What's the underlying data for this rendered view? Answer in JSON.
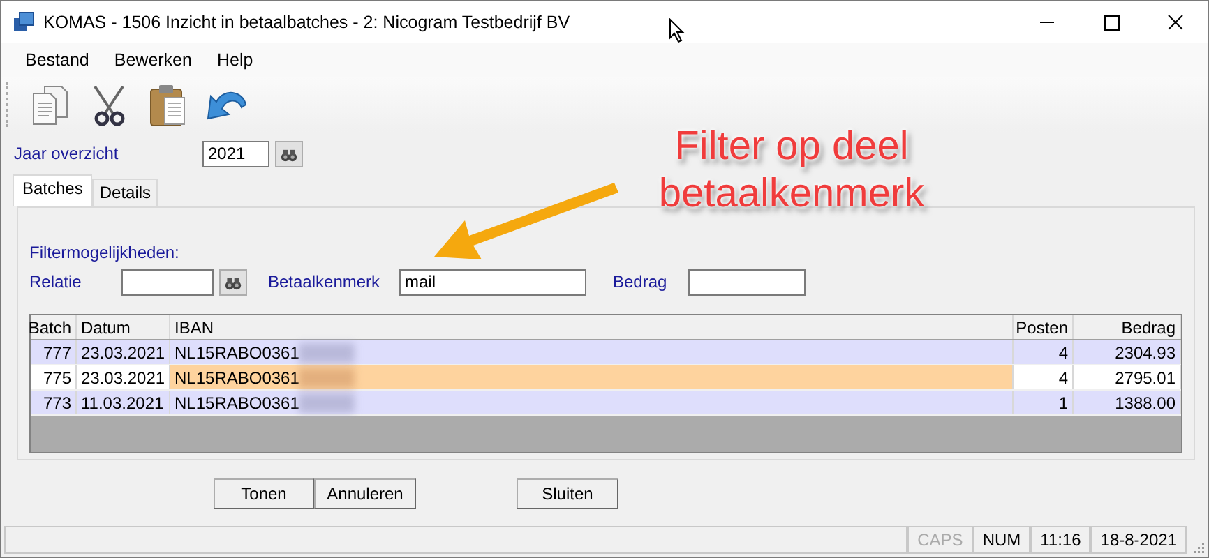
{
  "window": {
    "title": "KOMAS - 1506 Inzicht in betaalbatches - 2: Nicogram Testbedrijf BV"
  },
  "menu": [
    "Bestand",
    "Bewerken",
    "Help"
  ],
  "year": {
    "label": "Jaar overzicht",
    "value": "2021"
  },
  "tabs": [
    {
      "label": "Batches",
      "selected": true
    },
    {
      "label": "Details",
      "selected": false
    }
  ],
  "filter": {
    "heading": "Filtermogelijkheden:",
    "relatie_label": "Relatie",
    "kenmerk_label": "Betaalkenmerk",
    "kenmerk_value": "mail",
    "bedrag_label": "Bedrag"
  },
  "table": {
    "columns": [
      "Batch",
      "Datum",
      "IBAN",
      "Posten",
      "Bedrag"
    ],
    "rows": [
      {
        "cells": [
          "777",
          "23.03.2021",
          "NL15RABO0361",
          "4",
          "2304.93"
        ],
        "selected": false
      },
      {
        "cells": [
          "775",
          "23.03.2021",
          "NL15RABO0361",
          "4",
          "2795.01"
        ],
        "selected": true
      },
      {
        "cells": [
          "773",
          "11.03.2021",
          "NL15RABO0361",
          "1",
          "1388.00"
        ],
        "selected": false
      }
    ]
  },
  "buttons": [
    "Tonen",
    "Annuleren",
    "Sluiten"
  ],
  "status_bar": [
    {
      "text": "CAPS",
      "disabled": true
    },
    {
      "text": "NUM",
      "disabled": false
    },
    {
      "text": "11:16",
      "disabled": false
    },
    {
      "text": "18-8-2021",
      "disabled": false
    }
  ],
  "annotation": {
    "text": "Filter op deel\nbetaalkenmerk"
  }
}
